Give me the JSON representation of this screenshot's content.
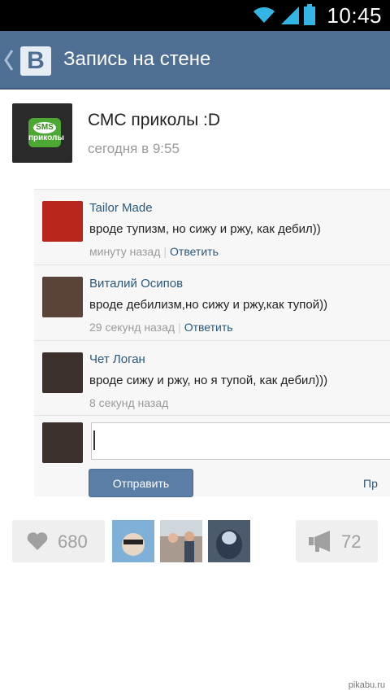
{
  "status_bar": {
    "time": "10:45",
    "icons": [
      "wifi-icon",
      "signal-icon",
      "battery-icon"
    ]
  },
  "header": {
    "title": "Запись на стене",
    "logo_letter": "B",
    "background": "#4f6e94"
  },
  "post": {
    "author": "СМС приколы :D",
    "time": "сегодня в 9:55",
    "avatar_text_top": "SMS",
    "avatar_text_bottom": "приколы"
  },
  "comments": [
    {
      "name": "Tailor Made",
      "text": "вроде тупизм, но сижу и ржу, как дебил))",
      "time": "минуту назад",
      "reply": "Ответить",
      "avatar_color": "#b8261c"
    },
    {
      "name": "Виталий Осипов",
      "text": "вроде дебилизм,но сижу и ржу,как тупой))",
      "time": "29 секунд назад",
      "reply": "Ответить",
      "avatar_color": "#5a4338"
    },
    {
      "name": "Чет Логан",
      "text": "вроде сижу и ржу, но я тупой, как дебил)))",
      "time": "8 секунд назад",
      "reply": "",
      "avatar_color": "#3b302b"
    }
  ],
  "reply_form": {
    "value": "",
    "send_label": "Отправить",
    "extra_label": "Пр"
  },
  "likes": {
    "count": "680"
  },
  "shares": {
    "count": "72"
  },
  "likers": [
    {
      "avatar_color": "#7fb0d8"
    },
    {
      "avatar_color": "#a89a8e"
    },
    {
      "avatar_color": "#4c5a6e"
    }
  ],
  "watermark": "pikabu.ru",
  "accent_colors": {
    "link": "#2b587a",
    "button": "#5b7ea6"
  }
}
